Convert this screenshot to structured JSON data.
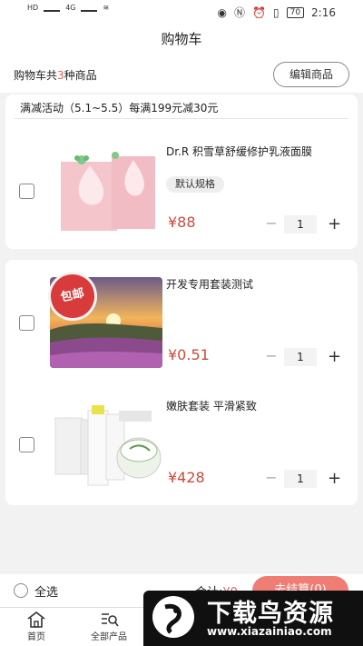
{
  "status_bar": {
    "time": "2:16",
    "battery": "70",
    "left_label_1": "HD",
    "left_label_2": "4G"
  },
  "header": {
    "title": "购物车"
  },
  "summary": {
    "prefix": "购物车共",
    "count": "3",
    "suffix": "种商品",
    "edit_label": "编辑商品"
  },
  "promo": {
    "text": "满减活动（5.1~5.5）每满199元减30元"
  },
  "items": [
    {
      "name": "Dr.R 积雪草舒缓修护乳液面膜",
      "spec": "默认规格",
      "price": "¥88",
      "qty": "1",
      "thumb_icon": "mask-product-image"
    },
    {
      "name": "开发专用套装测试",
      "badge": "包邮",
      "price": "¥0.51",
      "qty": "1",
      "thumb_icon": "landscape-image"
    },
    {
      "name": "嫩肤套装 平滑紧致",
      "price": "¥428",
      "qty": "1",
      "thumb_icon": "skincare-set-image"
    }
  ],
  "footer": {
    "select_all": "全选",
    "total_label": "合计:",
    "total_value": "¥0",
    "checkout": "去结算(0)"
  },
  "tabs": [
    {
      "label": "首页"
    },
    {
      "label": "全部产品"
    }
  ],
  "watermark": {
    "title": "下载鸟资源",
    "url": "www.xiazainiao.com"
  },
  "colors": {
    "accent": "#e65c5c",
    "price": "#c94b3a",
    "checkout_bg": "#f07d73"
  }
}
